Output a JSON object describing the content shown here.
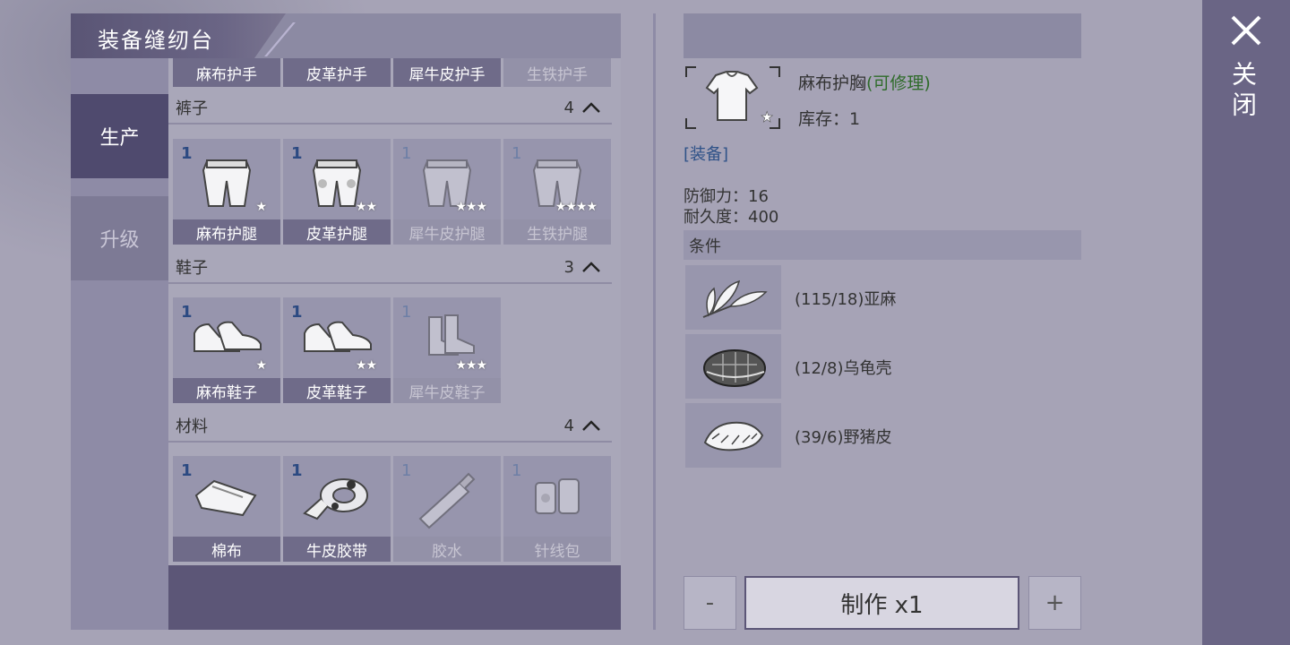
{
  "title": "装备缝纫台",
  "tabs": [
    {
      "label": "生产",
      "active": true
    },
    {
      "label": "升级",
      "active": false
    }
  ],
  "top_row_labels": [
    {
      "label": "麻布护手",
      "dim": false
    },
    {
      "label": "皮革护手",
      "dim": false
    },
    {
      "label": "犀牛皮护手",
      "dim": false
    },
    {
      "label": "生铁护手",
      "dim": true
    }
  ],
  "sections": [
    {
      "name": "裤子",
      "count": "4",
      "items": [
        {
          "count": "1",
          "label": "麻布护腿",
          "stars": "★",
          "dim": false,
          "icon": "pants-icon"
        },
        {
          "count": "1",
          "label": "皮革护腿",
          "stars": "★★",
          "dim": false,
          "icon": "pants-icon"
        },
        {
          "count": "1",
          "label": "犀牛皮护腿",
          "stars": "★★★",
          "dim": true,
          "icon": "pants-icon"
        },
        {
          "count": "1",
          "label": "生铁护腿",
          "stars": "★★★★",
          "dim": true,
          "icon": "pants-icon"
        }
      ]
    },
    {
      "name": "鞋子",
      "count": "3",
      "items": [
        {
          "count": "1",
          "label": "麻布鞋子",
          "stars": "★",
          "dim": false,
          "icon": "shoes-icon"
        },
        {
          "count": "1",
          "label": "皮革鞋子",
          "stars": "★★",
          "dim": false,
          "icon": "shoes-icon"
        },
        {
          "count": "1",
          "label": "犀牛皮鞋子",
          "stars": "★★★",
          "dim": true,
          "icon": "boots-icon"
        }
      ]
    },
    {
      "name": "材料",
      "count": "4",
      "items": [
        {
          "count": "1",
          "label": "棉布",
          "stars": "",
          "dim": false,
          "icon": "cloth-icon"
        },
        {
          "count": "1",
          "label": "牛皮胶带",
          "stars": "",
          "dim": false,
          "icon": "tape-icon"
        },
        {
          "count": "1",
          "label": "胶水",
          "stars": "",
          "dim": true,
          "icon": "glue-icon"
        },
        {
          "count": "1",
          "label": "针线包",
          "stars": "",
          "dim": true,
          "icon": "sewing-kit-icon"
        }
      ]
    }
  ],
  "detail": {
    "name": "麻布护胸",
    "repair_note": "(可修理)",
    "stock": "库存：1",
    "tag": "[装备]",
    "stats": [
      "防御力：16",
      "耐久度：400"
    ],
    "conditions_label": "条件",
    "materials": [
      {
        "text": "(115/18)亚麻",
        "icon": "flax-icon"
      },
      {
        "text": "(12/8)乌龟壳",
        "icon": "turtle-shell-icon"
      },
      {
        "text": "(39/6)野猪皮",
        "icon": "boar-hide-icon"
      }
    ],
    "minus_label": "-",
    "craft_label": "制作 x1",
    "plus_label": "+"
  },
  "close_label": "关闭",
  "colors": {
    "accent_dark": "#4f4a6e",
    "count_blue": "#2c4a82",
    "repair_green": "#2f6b2a",
    "tag_blue": "#2f5288"
  }
}
